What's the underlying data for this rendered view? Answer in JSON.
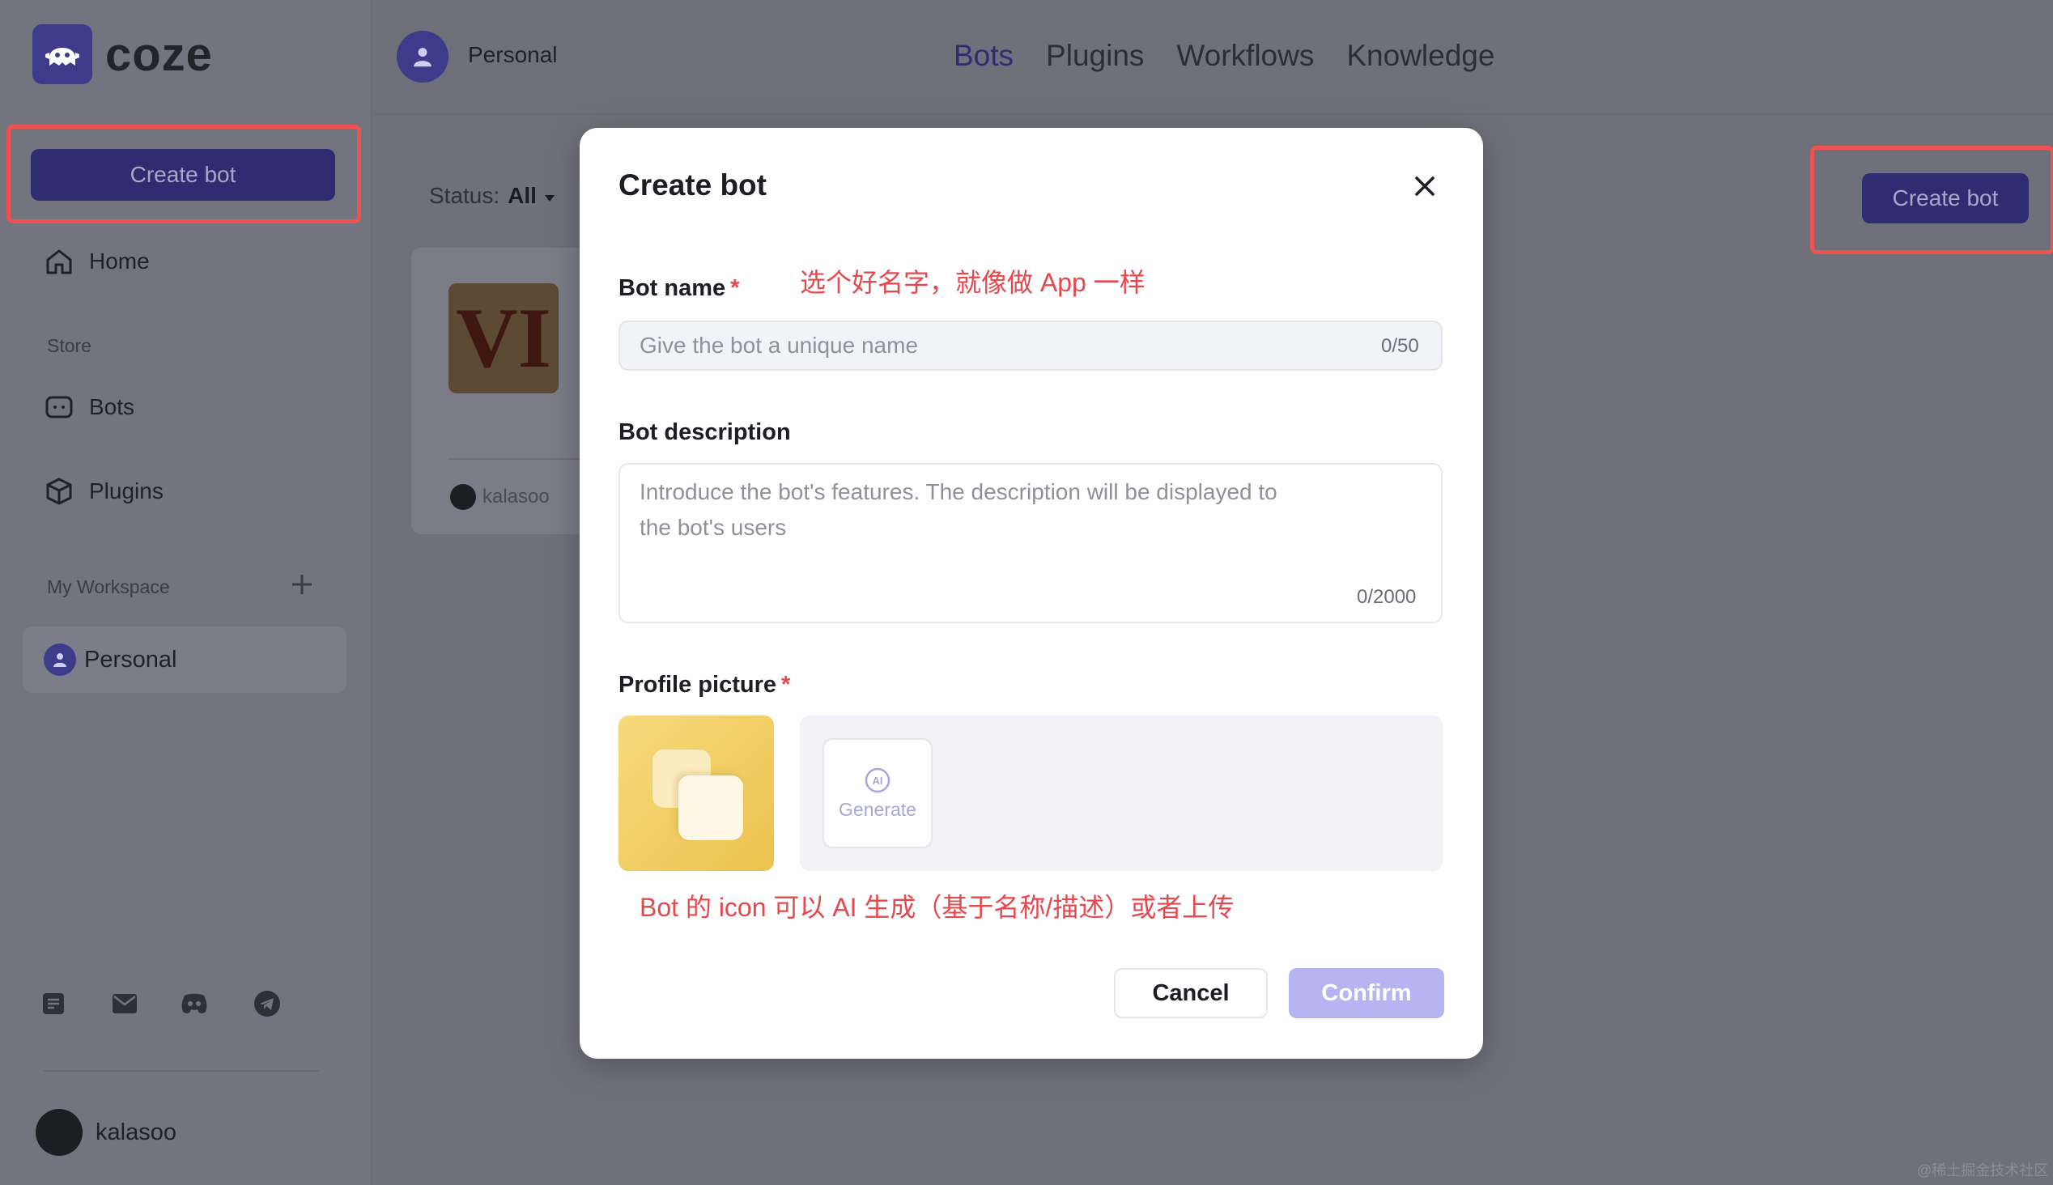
{
  "brand": {
    "name": "coze"
  },
  "sidebar": {
    "create_label": "Create bot",
    "home_label": "Home",
    "store_label": "Store",
    "bots_label": "Bots",
    "plugins_label": "Plugins",
    "workspace_label": "My Workspace",
    "personal_label": "Personal",
    "user_name": "kalasoo",
    "social_icons": [
      "doc-icon",
      "mail-icon",
      "discord-icon",
      "telegram-icon"
    ]
  },
  "header": {
    "workspace_name": "Personal",
    "tabs": [
      {
        "label": "Bots",
        "active": true
      },
      {
        "label": "Plugins",
        "active": false
      },
      {
        "label": "Workflows",
        "active": false
      },
      {
        "label": "Knowledge",
        "active": false
      }
    ]
  },
  "main": {
    "status_label": "Status:",
    "status_value": "All",
    "create_label": "Create bot",
    "card": {
      "image_text": "VI",
      "author": "kalasoo"
    },
    "watermark": "@稀土掘金技术社区"
  },
  "modal": {
    "title": "Create bot",
    "name_label": "Bot name",
    "name_placeholder": "Give the bot a unique name",
    "name_value": "",
    "name_counter": "0/50",
    "name_annotation": "选个好名字，就像做 App 一样",
    "description_label": "Bot description",
    "description_placeholder": "Introduce the bot's features. The description will be displayed to the bot's users",
    "description_counter": "0/2000",
    "profile_label": "Profile picture",
    "generate_label": "Generate",
    "icon_annotation": "Bot 的 icon 可以 AI 生成（基于名称/描述）或者上传",
    "required_mark": "*",
    "cancel_label": "Cancel",
    "confirm_label": "Confirm"
  },
  "colors": {
    "accent": "#2f2c72",
    "highlight_box": "#f0524f",
    "annotation": "#e5484d",
    "confirm_disabled": "#b7b4f2"
  }
}
